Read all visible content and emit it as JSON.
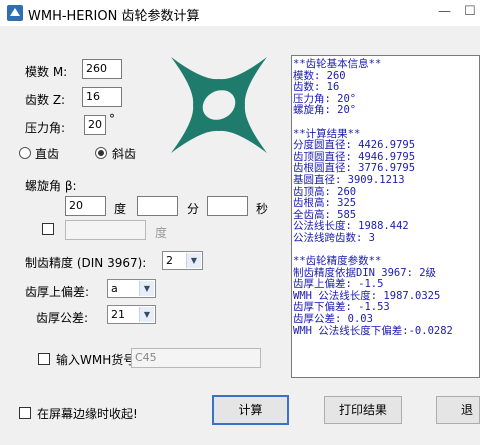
{
  "window": {
    "title": "WMH-HERION 齿轮参数计算",
    "minimize_glyph": "—",
    "maximize_glyph": "☐"
  },
  "form": {
    "module_label": "模数 M:",
    "module_value": "260",
    "teeth_label": "齿数 Z:",
    "teeth_value": "16",
    "pressure_angle_label": "压力角:",
    "pressure_angle_value": "20",
    "degree_sign": "°",
    "radio_spur": "直齿",
    "radio_helical": "斜齿",
    "selected_gear_type": "helical",
    "helix_angle_label": "螺旋角 β:",
    "helix_deg_value": "20",
    "unit_deg": "度",
    "helix_min_value": "",
    "unit_min": "分",
    "helix_sec_value": "",
    "unit_sec": "秒",
    "alt_deg_value": "",
    "alt_deg_unit": "度",
    "precision_label": "制齿精度 (DIN 3967):",
    "precision_value": "2",
    "upper_dev_label": "齿厚上偏差:",
    "upper_dev_value": "a",
    "tolerance_label": "齿厚公差:",
    "tolerance_value": "21",
    "wmh_checkbox_label": "输入WMH货号",
    "wmh_code_value": "C45"
  },
  "output_lines": [
    "**齿轮基本信息**",
    "模数: 260",
    "齿数: 16",
    "压力角: 20°",
    "螺旋角: 20°",
    "",
    "**计算结果**",
    "分度圆直径: 4426.9795",
    "齿顶圆直径: 4946.9795",
    "齿根圆直径: 3776.9795",
    "基圆直径: 3909.1213",
    "齿顶高: 260",
    "齿根高: 325",
    "全齿高: 585",
    "公法线长度: 1988.442",
    "公法线跨齿数: 3",
    "",
    "**齿轮精度参数**",
    "制齿精度依据DIN 3967: 2级",
    "齿厚上偏差: -1.5",
    "WMH 公法线长度: 1987.0325",
    "齿厚下偏差: -1.53",
    "齿厚公差: 0.03",
    "WMH 公法线长度下偏差:-0.0282"
  ],
  "bottom": {
    "collapse_label": "在屏幕边缘时收起!",
    "calculate_label": "计算",
    "print_label": "打印结果",
    "exit_label": "退出"
  },
  "colors": {
    "logo_teal": "#1f7c6c",
    "output_text": "#1b1bb0",
    "default_button_border": "#3a72c8"
  }
}
